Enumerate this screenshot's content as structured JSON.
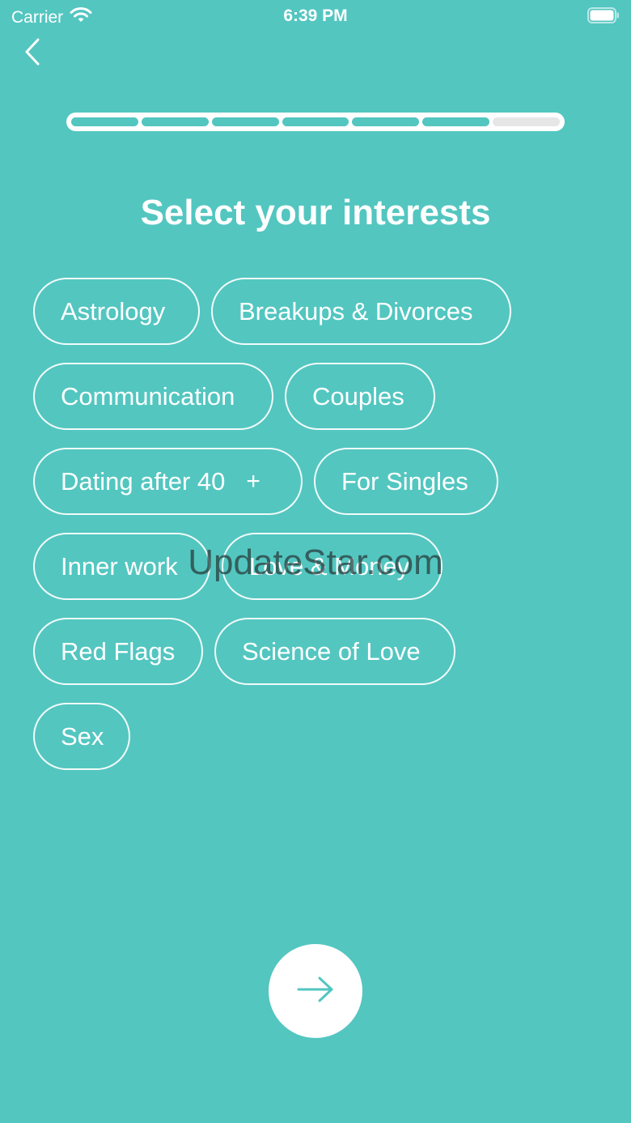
{
  "status_bar": {
    "carrier": "Carrier",
    "time": "6:39 PM",
    "icons": [
      "wifi-icon",
      "battery-icon"
    ]
  },
  "nav": {
    "back_icon": "chevron-left-icon"
  },
  "progress": {
    "total_steps": 7,
    "completed_steps": 6
  },
  "title": "Select your interests",
  "interests": [
    {
      "label": "Astrology"
    },
    {
      "label": "Breakups & Divorces"
    },
    {
      "label": "Communication"
    },
    {
      "label": "Couples"
    },
    {
      "label": "Dating after 40",
      "suffix": "+"
    },
    {
      "label": "For Singles"
    },
    {
      "label": "Inner work"
    },
    {
      "label": "Love & Money"
    },
    {
      "label": "Red Flags"
    },
    {
      "label": "Science of Love"
    },
    {
      "label": "Sex"
    }
  ],
  "watermark": "UpdateStar.com",
  "next_button": {
    "icon": "arrow-right-icon"
  },
  "colors": {
    "background": "#53c6c0",
    "accent": "#53c6c0",
    "text": "#ffffff"
  }
}
